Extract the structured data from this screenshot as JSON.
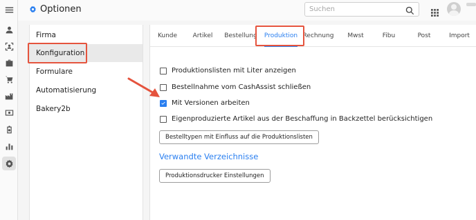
{
  "header": {
    "title": "Optionen",
    "search_placeholder": "Suchen"
  },
  "nav": {
    "items": [
      {
        "label": "Firma"
      },
      {
        "label": "Konfiguration"
      },
      {
        "label": "Formulare"
      },
      {
        "label": "Automatisierung"
      },
      {
        "label": "Bakery2b"
      }
    ],
    "active": "Konfiguration"
  },
  "tabs": [
    {
      "label": "Kunde"
    },
    {
      "label": "Artikel"
    },
    {
      "label": "Bestellung"
    },
    {
      "label": "Produktion"
    },
    {
      "label": "Rechnung"
    },
    {
      "label": "Mwst"
    },
    {
      "label": "Fibu"
    },
    {
      "label": "Post"
    },
    {
      "label": "Import"
    }
  ],
  "active_tab": "Produktion",
  "options": [
    {
      "label": "Produktionslisten mit Liter anzeigen",
      "checked": false
    },
    {
      "label": "Bestellnahme vom CashAssist schließen",
      "checked": false
    },
    {
      "label": "Mit Versionen arbeiten",
      "checked": true
    },
    {
      "label": "Eigenproduzierte Artikel aus der Beschaffung in Backzettel berücksichtigen",
      "checked": false
    }
  ],
  "buttons": {
    "bestelltypen": "Bestelltypen mit Einfluss auf die Produktionslisten",
    "produktionsdrucker": "Produktionsdrucker Einstellungen"
  },
  "section_title": "Verwandte Verzeichnisse",
  "colors": {
    "accent": "#2a7ff0",
    "highlight": "#e5533d"
  }
}
